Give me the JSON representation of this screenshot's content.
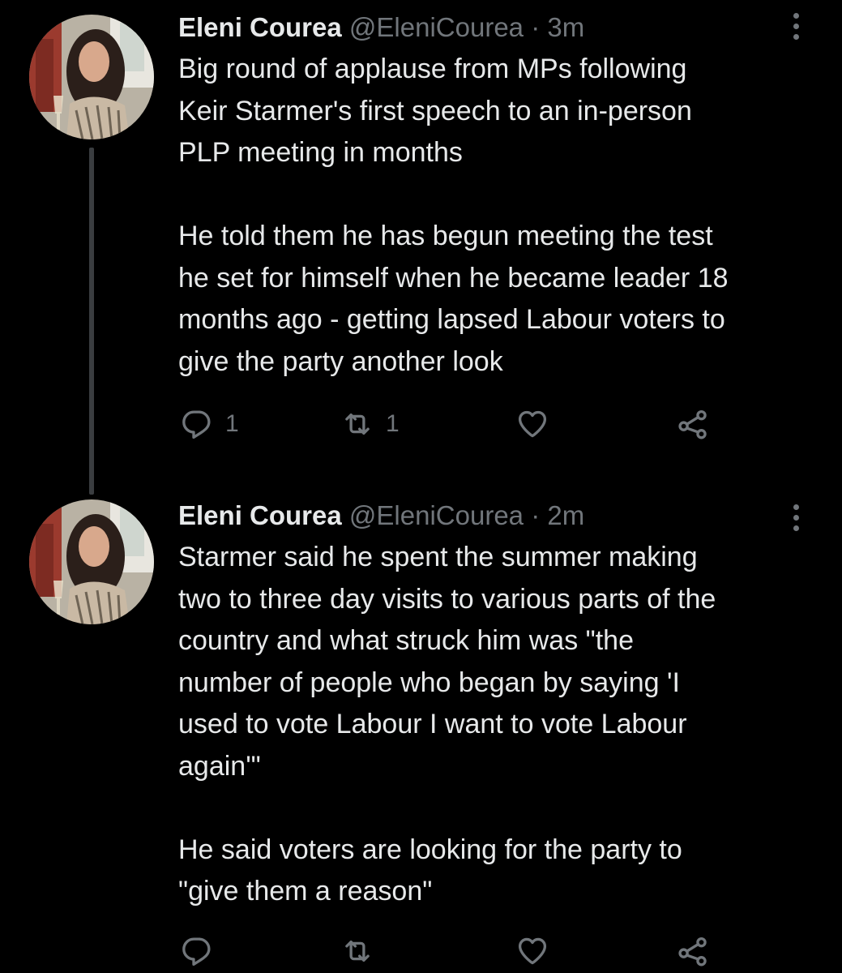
{
  "tweets": [
    {
      "display_name": "Eleni Courea",
      "handle": "@EleniCourea",
      "separator": "·",
      "time": "3m",
      "paragraphs": [
        "Big round of applause from MPs following\nKeir Starmer's first speech to an in-person\nPLP meeting in months",
        "He told them he has begun meeting the test\nhe set for himself when he became leader 18\nmonths ago - getting lapsed Labour voters to\ngive the party another look"
      ],
      "actions": {
        "reply_count": "1",
        "retweet_count": "1",
        "like_count": "",
        "reply_icon": "reply-icon",
        "retweet_icon": "retweet-icon",
        "like_icon": "heart-icon",
        "share_icon": "share-icon"
      }
    },
    {
      "display_name": "Eleni Courea",
      "handle": "@EleniCourea",
      "separator": "·",
      "time": "2m",
      "paragraphs": [
        "Starmer said he spent the summer making\ntwo to three day visits to various parts of the\ncountry and what struck him was \"the\nnumber of people who began by saying 'I\nused to vote Labour I want to vote Labour\nagain'\"",
        "He said voters are looking for the party to\n\"give them a reason\""
      ],
      "actions": {
        "reply_count": "",
        "retweet_count": "",
        "like_count": "",
        "reply_icon": "reply-icon",
        "retweet_icon": "retweet-icon",
        "like_icon": "heart-icon",
        "share_icon": "share-icon"
      }
    }
  ],
  "colors": {
    "background": "#000000",
    "primary_text": "#e7e9ea",
    "secondary_text": "#71767b",
    "thread_line": "#3a3d40"
  }
}
